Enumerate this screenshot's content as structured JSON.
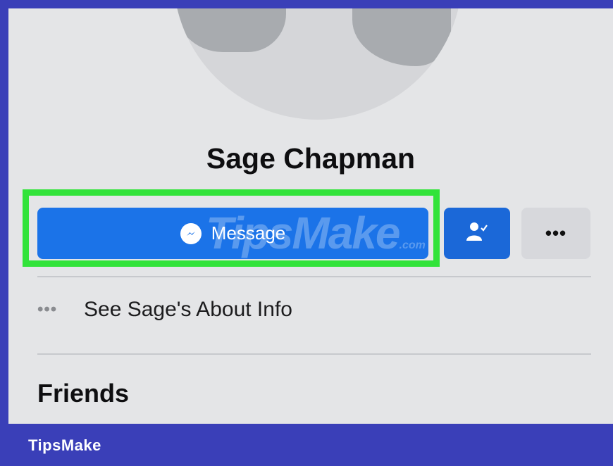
{
  "profile": {
    "name": "Sage Chapman"
  },
  "actions": {
    "message_label": "Message",
    "message_icon": "messenger-icon",
    "friend_icon": "friend-check-icon",
    "more_label": "•••"
  },
  "about": {
    "dots": "•••",
    "label": "See Sage's About Info"
  },
  "friends": {
    "title": "Friends"
  },
  "watermark": {
    "main": "TipsMake",
    "suffix": ".com"
  },
  "banner": {
    "text": "TipsMake"
  },
  "colors": {
    "primary_button": "#1b73e8",
    "highlight": "#32e33a",
    "frame": "#3a3fb8"
  }
}
